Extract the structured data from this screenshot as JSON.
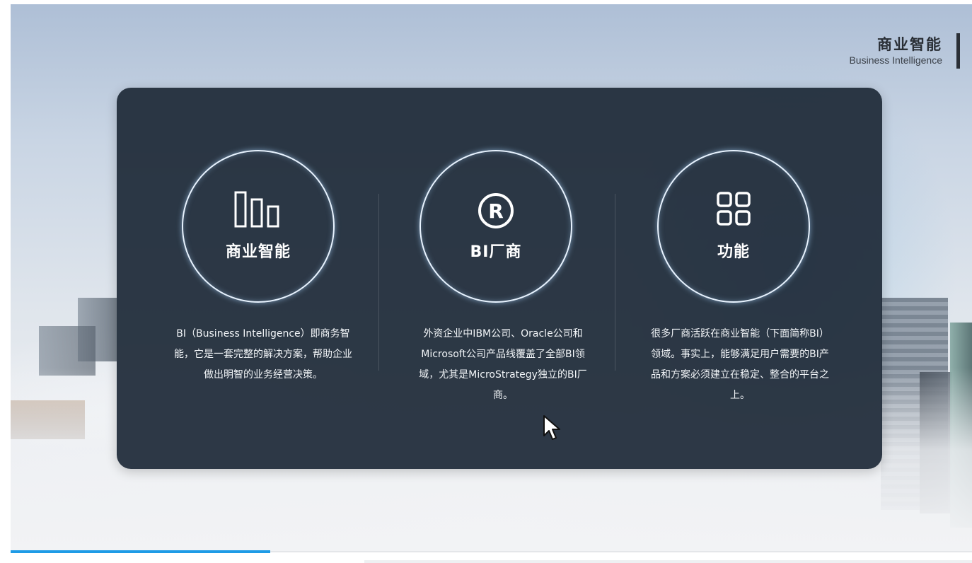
{
  "header": {
    "title": "商业智能",
    "subtitle": "Business Intelligence"
  },
  "cards": [
    {
      "icon": "bar-chart-icon",
      "label": "商业智能",
      "description": "BI（Business Intelligence）即商务智能，它是一套完整的解决方案，帮助企业做出明智的业务经营决策。"
    },
    {
      "icon": "registered-r-icon",
      "label": "BI厂商",
      "description": "外资企业中IBM公司、Oracle公司和Microsoft公司产品线覆盖了全部BI领域，尤其是MicroStrategy独立的BI厂商。"
    },
    {
      "icon": "grid-four-squares-icon",
      "label": "功能",
      "description": "很多厂商活跃在商业智能（下面简称BI）领域。事实上，能够满足用户需要的BI产品和方案必须建立在稳定、整合的平台之上。"
    }
  ],
  "playback": {
    "progress": 0.27
  },
  "colors": {
    "panel": "#1e2a38",
    "accent": "#1e9be6",
    "circle_glow": "#aad7ff"
  }
}
